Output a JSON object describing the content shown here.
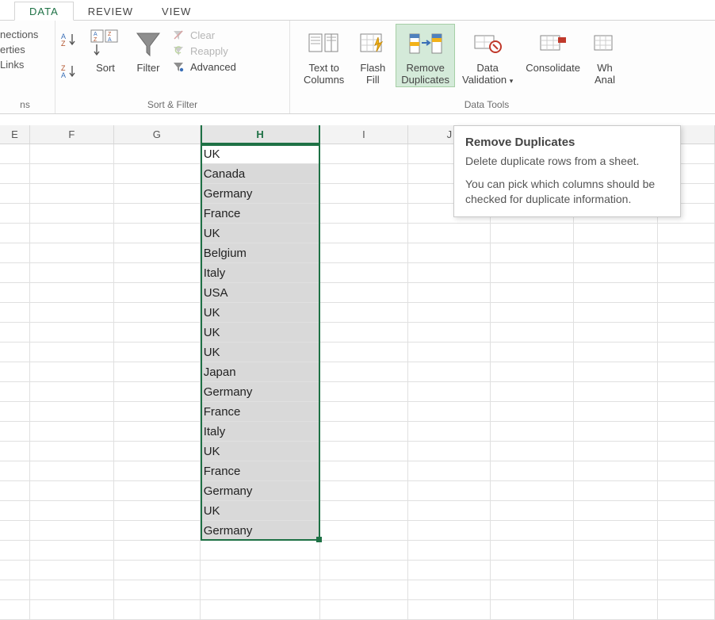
{
  "tabs": {
    "data": "DATA",
    "review": "REVIEW",
    "view": "VIEW"
  },
  "connections_group": {
    "items": [
      "nections",
      "erties",
      "Links"
    ],
    "label": "ns"
  },
  "sortfilter_group": {
    "sort": "Sort",
    "filter": "Filter",
    "opt_clear": "Clear",
    "opt_reapply": "Reapply",
    "opt_advanced": "Advanced",
    "label": "Sort & Filter"
  },
  "datatools_group": {
    "text_to_columns": "Text to\nColumns",
    "flash_fill": "Flash\nFill",
    "remove_dup": "Remove\nDuplicates",
    "data_validation": "Data\nValidation",
    "consolidate": "Consolidate",
    "whatif": "Wh\nAnal",
    "label": "Data Tools"
  },
  "tooltip": {
    "title": "Remove Duplicates",
    "line1": "Delete duplicate rows from a sheet.",
    "line2": "You can pick which columns should be checked for duplicate information."
  },
  "columns": {
    "E": "E",
    "F": "F",
    "G": "G",
    "H": "H",
    "I": "I",
    "J": "J"
  },
  "col_widths": {
    "E": 38,
    "F": 106,
    "G": 109,
    "H": 151,
    "I": 112,
    "J": 104,
    "K": 105,
    "L": 106,
    "rest": 72
  },
  "data_rows": [
    "UK",
    "Canada",
    "Germany",
    "France",
    "UK",
    "Belgium",
    "Italy",
    "USA",
    "UK",
    "UK",
    "UK",
    "Japan",
    "Germany",
    "France",
    "Italy",
    "UK",
    "France",
    "Germany",
    "UK",
    "Germany"
  ],
  "total_rows": 24
}
